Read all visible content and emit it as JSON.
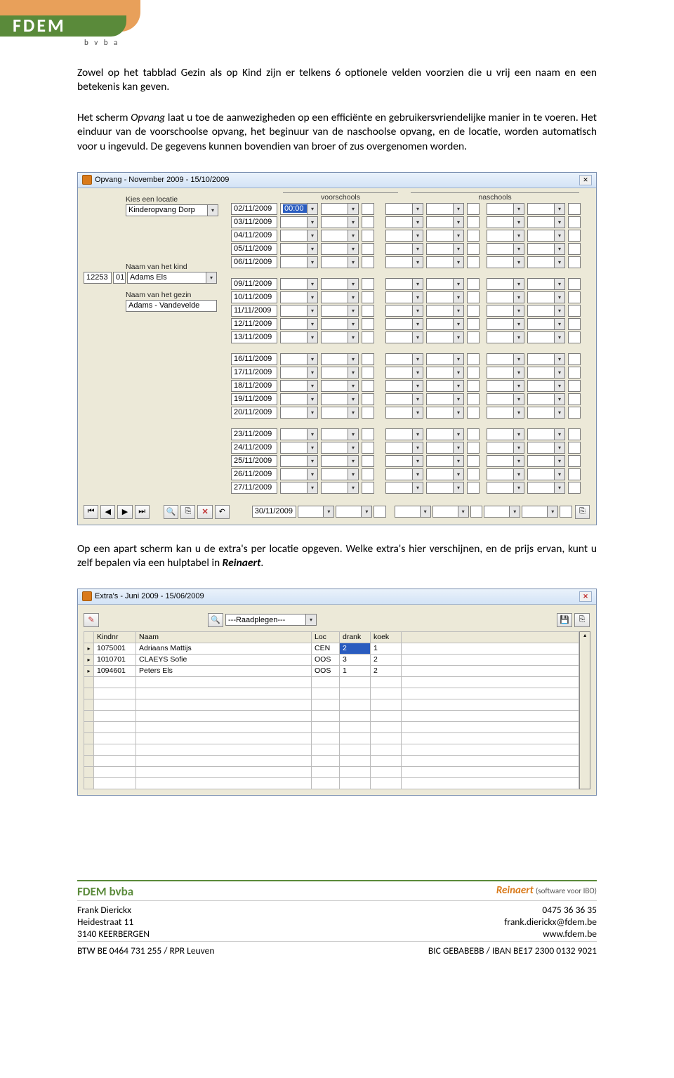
{
  "logo": {
    "name": "FDEM",
    "sub": "b v b a"
  },
  "para1": "Zowel op het tabblad Gezin als op Kind zijn er telkens 6 optionele velden voorzien die u vrij een naam en een betekenis kan geven.",
  "para2_a": "Het scherm ",
  "para2_em": "Opvang",
  "para2_b": " laat u toe de aanwezigheden op een efficiënte en gebruikersvriendelijke manier in te voeren. Het einduur van de voorschoolse opvang, het beginuur van de naschoolse opvang, en de locatie, worden automatisch voor u ingevuld. De gegevens kunnen bovendien van broer of zus overgenomen worden.",
  "opvang": {
    "title": "Opvang   -   November 2009   -   15/10/2009",
    "lbl_locatie": "Kies een locatie",
    "locatie": "Kinderopvang Dorp",
    "hdr_voor": "voorschools",
    "hdr_na": "naschools",
    "lbl_kind": "Naam van het kind",
    "kind_id1": "12253",
    "kind_id2": "01",
    "kind_naam": "Adams Els",
    "lbl_gezin": "Naam van het gezin",
    "gezin": "Adams - Vandevelde",
    "time_sel": "00:00",
    "week1": [
      "02/11/2009",
      "03/11/2009",
      "04/11/2009",
      "05/11/2009",
      "06/11/2009"
    ],
    "week2": [
      "09/11/2009",
      "10/11/2009",
      "11/11/2009",
      "12/11/2009",
      "13/11/2009"
    ],
    "week3": [
      "16/11/2009",
      "17/11/2009",
      "18/11/2009",
      "19/11/2009",
      "20/11/2009"
    ],
    "week4": [
      "23/11/2009",
      "24/11/2009",
      "25/11/2009",
      "26/11/2009",
      "27/11/2009"
    ],
    "last": "30/11/2009"
  },
  "para3_a": "Op een apart scherm kan u de extra's per locatie opgeven. Welke extra's hier verschijnen, en de prijs ervan, kunt u zelf bepalen via een hulptabel in ",
  "para3_em": "Reinaert",
  "para3_b": ".",
  "extras": {
    "title": "Extra's   -   Juni 2009   -   15/06/2009",
    "mode": "---Raadplegen---",
    "cols": [
      "Kindnr",
      "Naam",
      "Loc",
      "drank",
      "koek"
    ],
    "rows": [
      {
        "nr": "1075001",
        "naam": "Adriaans Mattijs",
        "loc": "CEN",
        "drank": "2",
        "koek": "1",
        "sel": true
      },
      {
        "nr": "1010701",
        "naam": "CLAEYS Sofie",
        "loc": "OOS",
        "drank": "3",
        "koek": "2",
        "sel": false
      },
      {
        "nr": "1094601",
        "naam": "Peters Els",
        "loc": "OOS",
        "drank": "1",
        "koek": "2",
        "sel": false
      }
    ]
  },
  "footer": {
    "company": "FDEM bvba",
    "product": "Reinaert",
    "product_sub": "(software voor IBO)",
    "name": "Frank Dierickx",
    "phone": "0475 36 36 35",
    "addr": "Heidestraat 11",
    "email": "frank.dierickx@fdem.be",
    "city": "3140 KEERBERGEN",
    "web": "www.fdem.be",
    "btw": "BTW BE 0464 731 255 / RPR Leuven",
    "bank": "BIC GEBABEBB / IBAN BE17 2300 0132 9021"
  }
}
